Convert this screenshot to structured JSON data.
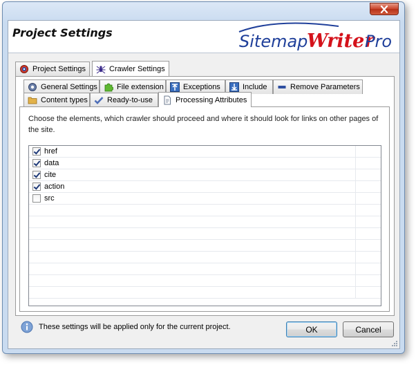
{
  "window": {
    "close_glyph": "✕"
  },
  "header": {
    "title": "Project Settings",
    "logo_part1": "Sitemap",
    "logo_part2": "Writer",
    "logo_part3": "Pro"
  },
  "main_tabs": [
    {
      "label": "Project Settings",
      "icon": "gear-icon",
      "active": false
    },
    {
      "label": "Crawler Settings",
      "icon": "spider-icon",
      "active": true
    }
  ],
  "sub_tabs_row1": [
    {
      "label": "General Settings",
      "icon": "gear-icon"
    },
    {
      "label": "File extension",
      "icon": "puzzle-icon"
    },
    {
      "label": "Exceptions",
      "icon": "upload-arrow-icon"
    },
    {
      "label": "Include",
      "icon": "download-arrow-icon"
    },
    {
      "label": "Remove Parameters",
      "icon": "minus-icon"
    }
  ],
  "sub_tabs_row2": [
    {
      "label": "Content types",
      "icon": "folder-icon"
    },
    {
      "label": "Ready-to-use",
      "icon": "checkmark-icon"
    },
    {
      "label": "Processing Attributes",
      "icon": "document-icon",
      "active": true
    }
  ],
  "description": "Choose the elements, which crawler should proceed and where it should look for  links on other pages of the site.",
  "attributes": [
    {
      "name": "href",
      "checked": true
    },
    {
      "name": "data",
      "checked": true
    },
    {
      "name": "cite",
      "checked": true
    },
    {
      "name": "action",
      "checked": true
    },
    {
      "name": "src",
      "checked": false
    }
  ],
  "footer": {
    "info_text": "These settings will be applied only for the current project.",
    "ok_label": "OK",
    "cancel_label": "Cancel"
  },
  "colors": {
    "logo_blue": "#1f3f9a",
    "logo_red": "#d4121b",
    "accent_blue": "#3c7fb1",
    "close_red": "#c9442a"
  }
}
